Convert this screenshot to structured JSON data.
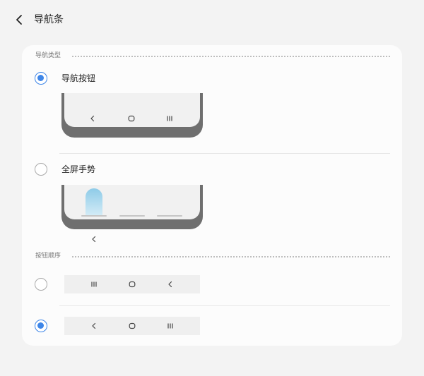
{
  "header": {
    "title": "导航条",
    "back_icon": "chevron-left-icon"
  },
  "navigation_type": {
    "section_label": "导航类型",
    "options": [
      {
        "label": "导航按钮",
        "selected": true,
        "preview_icons": [
          "back-chevron-icon",
          "home-circle-icon",
          "recents-bars-icon"
        ]
      },
      {
        "label": "全屏手势",
        "selected": false,
        "preview_icons": [
          "gesture-pill",
          "gesture-bar",
          "gesture-bar",
          "back-chevron-icon"
        ]
      }
    ]
  },
  "button_order": {
    "section_label": "按钮顺序",
    "options": [
      {
        "selected": false,
        "order": [
          "recents-bars-icon",
          "home-circle-icon",
          "back-chevron-icon"
        ]
      },
      {
        "selected": true,
        "order": [
          "back-chevron-icon",
          "home-circle-icon",
          "recents-bars-icon"
        ]
      }
    ]
  },
  "colors": {
    "accent": "#3e86e8",
    "background": "#f3f3f3",
    "card": "#fcfcfc",
    "phone_frame": "#6f6f6f",
    "gesture_pill": "#8ecbe8"
  }
}
